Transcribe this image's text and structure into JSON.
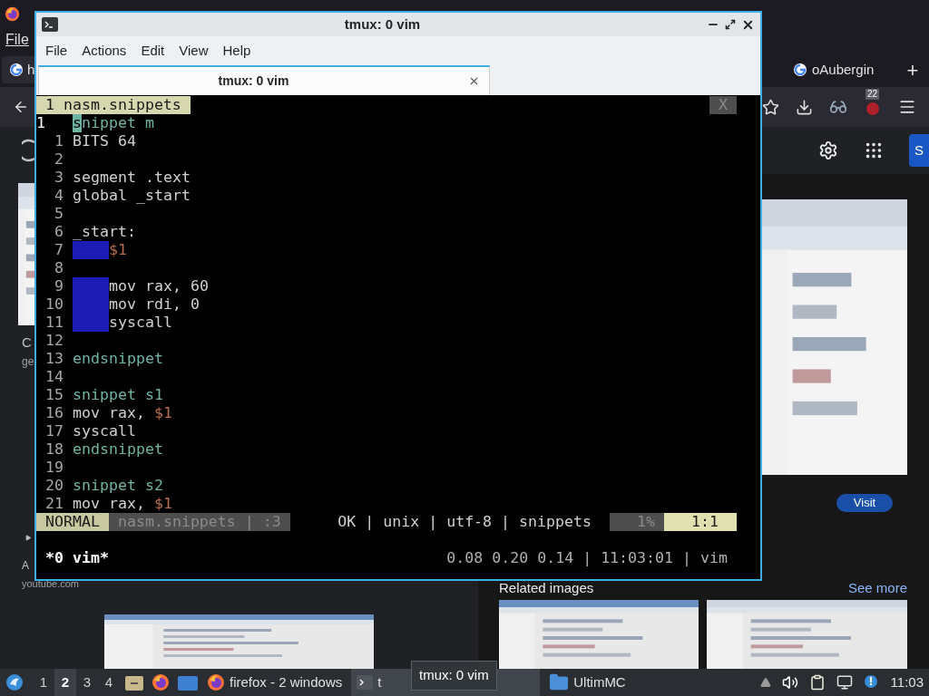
{
  "browser": {
    "menu": "File",
    "tabs": [
      {
        "label": "h",
        "selected": false
      },
      {
        "label": "oAubergin",
        "selected": false
      }
    ],
    "new_tab": "+",
    "badge": "22",
    "page": {
      "header_button": "S",
      "result_title": "C",
      "result_source": "ge",
      "video_title": "A",
      "video_source": "youtube.com",
      "visit": "Visit",
      "related": "Related images",
      "see_more": "See more"
    }
  },
  "terminal": {
    "title": "tmux: 0 vim",
    "menu": [
      "File",
      "Actions",
      "Edit",
      "View",
      "Help"
    ],
    "tab": "tmux: 0 vim",
    "vim": {
      "buffer_tab": "1 nasm.snippets",
      "close": "X",
      "lines": [
        {
          "number": "1",
          "current": true,
          "indent": false,
          "tokens": [
            {
              "kind": "cursor",
              "text": "s"
            },
            {
              "kind": "keyword",
              "text": "nippet m"
            }
          ]
        },
        {
          "number": "1",
          "current": false,
          "indent": false,
          "tokens": [
            {
              "kind": "plain",
              "text": "BITS 64"
            }
          ]
        },
        {
          "number": "2",
          "current": false,
          "indent": false
        },
        {
          "number": "3",
          "current": false,
          "indent": false,
          "tokens": [
            {
              "kind": "plain",
              "text": "segment .text"
            }
          ]
        },
        {
          "number": "4",
          "current": false,
          "indent": false,
          "tokens": [
            {
              "kind": "plain",
              "text": "global _start"
            }
          ]
        },
        {
          "number": "5",
          "current": false,
          "indent": false
        },
        {
          "number": "6",
          "current": false,
          "indent": false,
          "tokens": [
            {
              "kind": "plain",
              "text": "_start:"
            }
          ]
        },
        {
          "number": "7",
          "current": false,
          "indent": true,
          "tokens": [
            {
              "kind": "placeholder",
              "text": "$1"
            }
          ]
        },
        {
          "number": "8",
          "current": false,
          "indent": false
        },
        {
          "number": "9",
          "current": false,
          "indent": true,
          "tokens": [
            {
              "kind": "plain",
              "text": "mov rax, 60"
            }
          ]
        },
        {
          "number": "10",
          "current": false,
          "indent": true,
          "tokens": [
            {
              "kind": "plain",
              "text": "mov rdi, 0"
            }
          ]
        },
        {
          "number": "11",
          "current": false,
          "indent": true,
          "tokens": [
            {
              "kind": "plain",
              "text": "syscall"
            }
          ]
        },
        {
          "number": "12",
          "current": false,
          "indent": false
        },
        {
          "number": "13",
          "current": false,
          "indent": false,
          "tokens": [
            {
              "kind": "keyword",
              "text": "endsnippet"
            }
          ]
        },
        {
          "number": "14",
          "current": false,
          "indent": false
        },
        {
          "number": "15",
          "current": false,
          "indent": false,
          "tokens": [
            {
              "kind": "keyword",
              "text": "snippet s1"
            }
          ]
        },
        {
          "number": "16",
          "current": false,
          "indent": false,
          "tokens": [
            {
              "kind": "plain",
              "text": "mov rax, "
            },
            {
              "kind": "placeholder",
              "text": "$1"
            }
          ]
        },
        {
          "number": "17",
          "current": false,
          "indent": false,
          "tokens": [
            {
              "kind": "plain",
              "text": "syscall"
            }
          ]
        },
        {
          "number": "18",
          "current": false,
          "indent": false,
          "tokens": [
            {
              "kind": "keyword",
              "text": "endsnippet"
            }
          ]
        },
        {
          "number": "19",
          "current": false,
          "indent": false
        },
        {
          "number": "20",
          "current": false,
          "indent": false,
          "tokens": [
            {
              "kind": "keyword",
              "text": "snippet s2"
            }
          ]
        },
        {
          "number": "21",
          "current": false,
          "indent": false,
          "tokens": [
            {
              "kind": "plain",
              "text": "mov rax, "
            },
            {
              "kind": "placeholder",
              "text": "$1"
            }
          ]
        }
      ],
      "status": [
        {
          "kind": "mode",
          "text": "NORMAL"
        },
        {
          "kind": "file",
          "text": "nasm.snippets | :3"
        },
        {
          "kind": "info",
          "text": "OK | unix | utf-8 | snippets"
        },
        {
          "kind": "percent",
          "text": "1%"
        },
        {
          "kind": "position",
          "text": "1:1"
        }
      ]
    },
    "tmux": {
      "window": "*0 vim*",
      "right": "0.08 0.20 0.14 | 11:03:01 | vim"
    }
  },
  "taskbar": {
    "workspaces": [
      {
        "label": "1",
        "selected": false
      },
      {
        "label": "2",
        "selected": true
      },
      {
        "label": "3",
        "selected": false
      },
      {
        "label": "4",
        "selected": false
      }
    ],
    "tasks": [
      {
        "kind": "firefox",
        "label": "firefox - 2 windows",
        "active": false
      },
      {
        "kind": "terminal",
        "label": "t",
        "active": true
      },
      {
        "kind": "folder",
        "label": "UltimMC",
        "active": false
      }
    ],
    "clock": "11:03"
  },
  "tooltip": "tmux: 0 vim"
}
